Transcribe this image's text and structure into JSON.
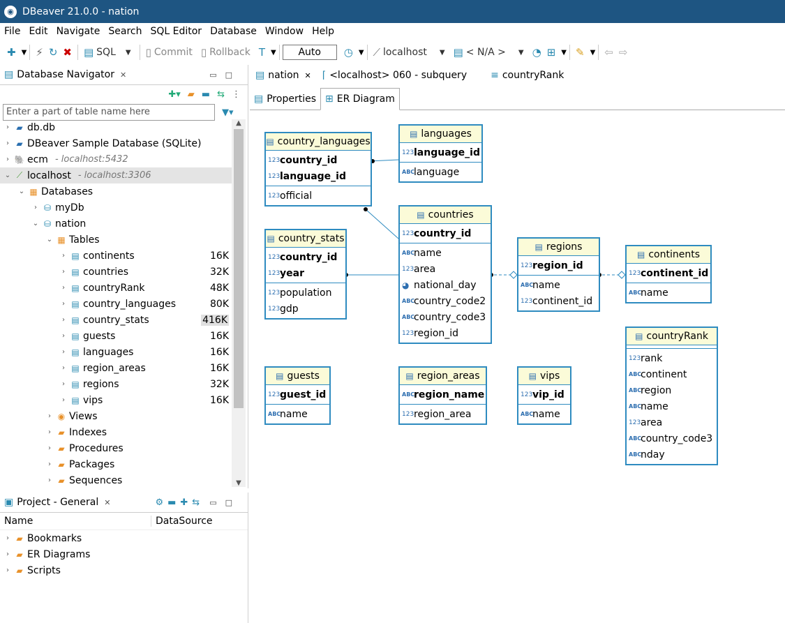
{
  "window": {
    "title": "DBeaver 21.0.0 - nation"
  },
  "menu": [
    "File",
    "Edit",
    "Navigate",
    "Search",
    "SQL Editor",
    "Database",
    "Window",
    "Help"
  ],
  "toolbar": {
    "sql_label": "SQL",
    "commit_label": "Commit",
    "rollback_label": "Rollback",
    "auto_label": "Auto",
    "connection_label": "localhost",
    "schema_label": "< N/A >"
  },
  "navigator": {
    "title": "Database Navigator",
    "filter_placeholder": "Enter a part of table name here",
    "tree": [
      {
        "label": "db.db",
        "sub": "",
        "size": "",
        "level": 0,
        "arrow": "›",
        "icon": "sqlite-icon"
      },
      {
        "label": "DBeaver Sample Database (SQLite)",
        "sub": "",
        "size": "",
        "level": 0,
        "arrow": "›",
        "icon": "sqlite-icon"
      },
      {
        "label": "ecm",
        "sub": "- localhost:5432",
        "size": "",
        "level": 0,
        "arrow": "›",
        "icon": "postgres-icon"
      },
      {
        "label": "localhost",
        "sub": "- localhost:3306",
        "size": "",
        "level": 0,
        "arrow": "⌄",
        "icon": "mysql-icon"
      },
      {
        "label": "Databases",
        "sub": "",
        "size": "",
        "level": 1,
        "arrow": "⌄",
        "icon": "databases-icon"
      },
      {
        "label": "myDb",
        "sub": "",
        "size": "",
        "level": 2,
        "arrow": "›",
        "icon": "database-icon"
      },
      {
        "label": "nation",
        "sub": "",
        "size": "",
        "level": 2,
        "arrow": "⌄",
        "icon": "database-icon"
      },
      {
        "label": "Tables",
        "sub": "",
        "size": "",
        "level": 3,
        "arrow": "⌄",
        "icon": "tables-icon"
      },
      {
        "label": "continents",
        "sub": "",
        "size": "16K",
        "level": 4,
        "arrow": "›",
        "icon": "table-icon"
      },
      {
        "label": "countries",
        "sub": "",
        "size": "32K",
        "level": 4,
        "arrow": "›",
        "icon": "table-icon"
      },
      {
        "label": "countryRank",
        "sub": "",
        "size": "48K",
        "level": 4,
        "arrow": "›",
        "icon": "table-icon"
      },
      {
        "label": "country_languages",
        "sub": "",
        "size": "80K",
        "level": 4,
        "arrow": "›",
        "icon": "table-icon"
      },
      {
        "label": "country_stats",
        "sub": "",
        "size": "416K",
        "level": 4,
        "arrow": "›",
        "icon": "table-icon"
      },
      {
        "label": "guests",
        "sub": "",
        "size": "16K",
        "level": 4,
        "arrow": "›",
        "icon": "table-icon"
      },
      {
        "label": "languages",
        "sub": "",
        "size": "16K",
        "level": 4,
        "arrow": "›",
        "icon": "table-icon"
      },
      {
        "label": "region_areas",
        "sub": "",
        "size": "16K",
        "level": 4,
        "arrow": "›",
        "icon": "table-icon"
      },
      {
        "label": "regions",
        "sub": "",
        "size": "32K",
        "level": 4,
        "arrow": "›",
        "icon": "table-icon"
      },
      {
        "label": "vips",
        "sub": "",
        "size": "16K",
        "level": 4,
        "arrow": "›",
        "icon": "table-icon"
      },
      {
        "label": "Views",
        "sub": "",
        "size": "",
        "level": 3,
        "arrow": "›",
        "icon": "views-icon"
      },
      {
        "label": "Indexes",
        "sub": "",
        "size": "",
        "level": 3,
        "arrow": "›",
        "icon": "folder-icon"
      },
      {
        "label": "Procedures",
        "sub": "",
        "size": "",
        "level": 3,
        "arrow": "›",
        "icon": "folder-icon"
      },
      {
        "label": "Packages",
        "sub": "",
        "size": "",
        "level": 3,
        "arrow": "›",
        "icon": "folder-icon"
      },
      {
        "label": "Sequences",
        "sub": "",
        "size": "",
        "level": 3,
        "arrow": "›",
        "icon": "folder-icon"
      }
    ]
  },
  "project": {
    "title": "Project - General",
    "col_name": "Name",
    "col_datasource": "DataSource",
    "items": [
      "Bookmarks",
      "ER Diagrams",
      "Scripts"
    ]
  },
  "editor": {
    "tabs": [
      "nation",
      "<localhost> 060 - subquery",
      "countryRank"
    ],
    "subtabs": [
      "Properties",
      "ER Diagram"
    ]
  },
  "er": {
    "country_languages": {
      "title": "country_languages",
      "keys": [
        {
          "t": "123",
          "n": "country_id"
        },
        {
          "t": "123",
          "n": "language_id"
        }
      ],
      "cols": [
        {
          "t": "123",
          "n": "official"
        }
      ]
    },
    "languages": {
      "title": "languages",
      "keys": [
        {
          "t": "123",
          "n": "language_id"
        }
      ],
      "cols": [
        {
          "t": "ABC",
          "n": "language"
        }
      ]
    },
    "countries": {
      "title": "countries",
      "keys": [
        {
          "t": "123",
          "n": "country_id"
        }
      ],
      "cols": [
        {
          "t": "ABC",
          "n": "name"
        },
        {
          "t": "123",
          "n": "area"
        },
        {
          "t": "CLK",
          "n": "national_day"
        },
        {
          "t": "ABC",
          "n": "country_code2"
        },
        {
          "t": "ABC",
          "n": "country_code3"
        },
        {
          "t": "123",
          "n": "region_id"
        }
      ]
    },
    "country_stats": {
      "title": "country_stats",
      "keys": [
        {
          "t": "123",
          "n": "country_id"
        },
        {
          "t": "123",
          "n": "year"
        }
      ],
      "cols": [
        {
          "t": "123",
          "n": "population"
        },
        {
          "t": "123",
          "n": "gdp"
        }
      ]
    },
    "regions": {
      "title": "regions",
      "keys": [
        {
          "t": "123",
          "n": "region_id"
        }
      ],
      "cols": [
        {
          "t": "ABC",
          "n": "name"
        },
        {
          "t": "123",
          "n": "continent_id"
        }
      ]
    },
    "continents": {
      "title": "continents",
      "keys": [
        {
          "t": "123",
          "n": "continent_id"
        }
      ],
      "cols": [
        {
          "t": "ABC",
          "n": "name"
        }
      ]
    },
    "countryRank": {
      "title": "countryRank",
      "keys": [],
      "cols": [
        {
          "t": "123",
          "n": "rank"
        },
        {
          "t": "ABC",
          "n": "continent"
        },
        {
          "t": "ABC",
          "n": "region"
        },
        {
          "t": "ABC",
          "n": "name"
        },
        {
          "t": "123",
          "n": "area"
        },
        {
          "t": "ABC",
          "n": "country_code3"
        },
        {
          "t": "ABC",
          "n": "nday"
        }
      ]
    },
    "guests": {
      "title": "guests",
      "keys": [
        {
          "t": "123",
          "n": "guest_id"
        }
      ],
      "cols": [
        {
          "t": "ABC",
          "n": "name"
        }
      ]
    },
    "region_areas": {
      "title": "region_areas",
      "keys": [
        {
          "t": "ABC",
          "n": "region_name"
        }
      ],
      "cols": [
        {
          "t": "123",
          "n": "region_area"
        }
      ]
    },
    "vips": {
      "title": "vips",
      "keys": [
        {
          "t": "123",
          "n": "vip_id"
        }
      ],
      "cols": [
        {
          "t": "ABC",
          "n": "name"
        }
      ]
    }
  }
}
